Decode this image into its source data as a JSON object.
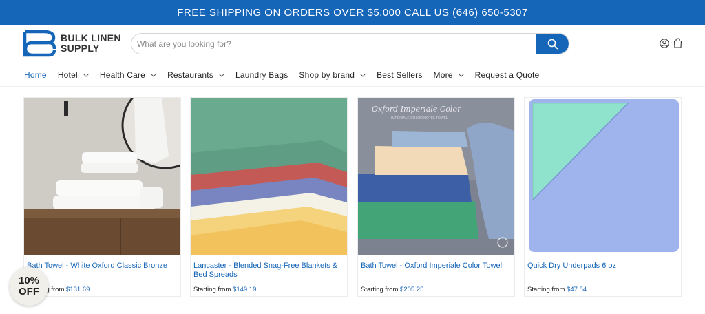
{
  "announcement": "FREE SHIPPING ON ORDERS OVER $5,000 CALL US (646) 650-5307",
  "brand": {
    "line1": "BULK LINEN",
    "line2": "SUPPLY",
    "color": "#1565b8"
  },
  "search": {
    "placeholder": "What are you looking for?",
    "value": ""
  },
  "nav": [
    {
      "label": "Home",
      "active": true,
      "dropdown": false
    },
    {
      "label": "Hotel",
      "dropdown": true
    },
    {
      "label": "Health Care",
      "dropdown": true
    },
    {
      "label": "Restaurants",
      "dropdown": true
    },
    {
      "label": "Laundry Bags",
      "dropdown": false
    },
    {
      "label": "Shop by brand",
      "dropdown": true
    },
    {
      "label": "Best Sellers",
      "dropdown": false
    },
    {
      "label": "More",
      "dropdown": true
    },
    {
      "label": "Request a Quote",
      "dropdown": false
    }
  ],
  "products": [
    {
      "title": "Bath Towel - White Oxford Classic Bronze",
      "price_prefix": "Starting from",
      "price": "$131.69"
    },
    {
      "title": "Lancaster - Blended Snag-Free Blankets & Bed Spreads",
      "price_prefix": "Starting from",
      "price": "$149.19"
    },
    {
      "title": "Bath Towel - Oxford Imperiale Color Towel",
      "price_prefix": "Starting from",
      "price": "$205.25",
      "image_caption": "Oxford Imperiale Color",
      "image_subcaption": "IMPERIALE COLOR HOTEL TOWEL"
    },
    {
      "title": "Quick Dry Underpads 6 oz",
      "price_prefix": "Starting from",
      "price": "$47.84"
    }
  ],
  "discount_badge": {
    "line1": "10%",
    "line2": "OFF"
  }
}
